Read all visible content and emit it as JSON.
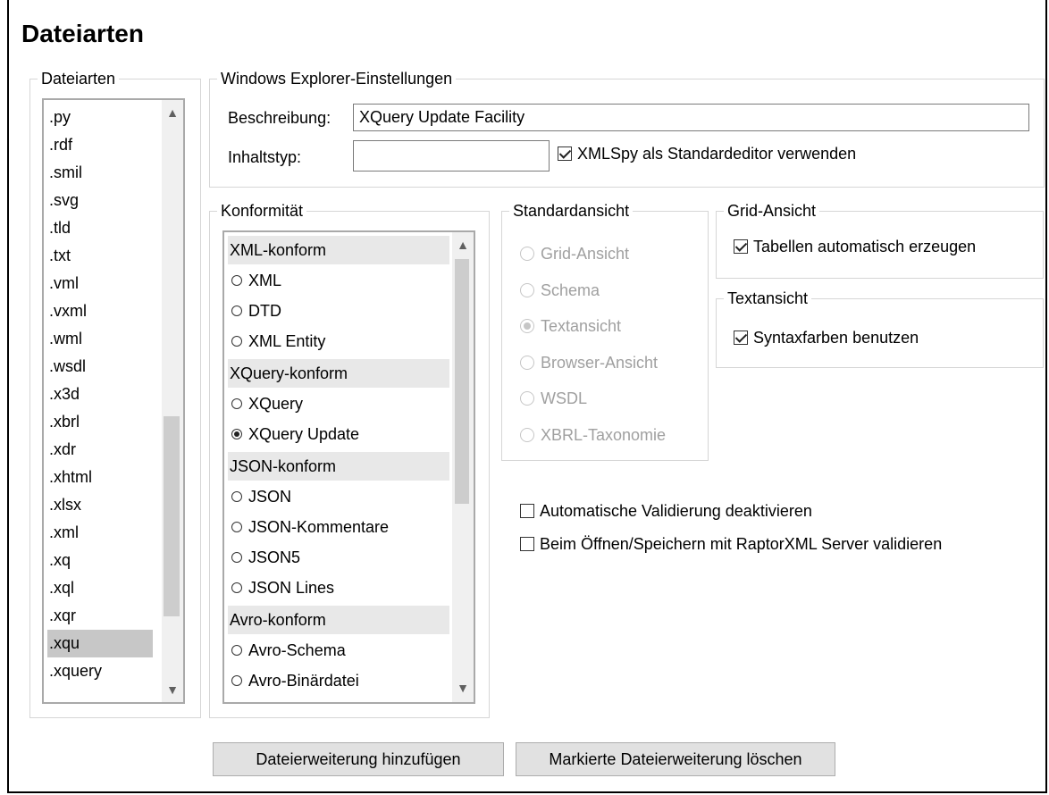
{
  "title": "Dateiarten",
  "filetypes": {
    "legend": "Dateiarten",
    "items": [
      ".py",
      ".rdf",
      ".smil",
      ".svg",
      ".tld",
      ".txt",
      ".vml",
      ".vxml",
      ".wml",
      ".wsdl",
      ".x3d",
      ".xbrl",
      ".xdr",
      ".xhtml",
      ".xlsx",
      ".xml",
      ".xq",
      ".xql",
      ".xqr",
      ".xqu",
      ".xquery"
    ],
    "selected": ".xqu"
  },
  "explorer": {
    "legend": "Windows Explorer-Einstellungen",
    "description_label": "Beschreibung:",
    "description_value": "XQuery Update Facility",
    "content_type_label": "Inhaltstyp:",
    "content_type_value": "",
    "default_editor_label": "XMLSpy als Standardeditor verwenden",
    "default_editor_checked": true
  },
  "conformance": {
    "legend": "Konformität",
    "groups": [
      {
        "header": "XML-konform",
        "items": [
          {
            "label": "XML",
            "checked": false
          },
          {
            "label": "DTD",
            "checked": false
          },
          {
            "label": "XML Entity",
            "checked": false
          }
        ]
      },
      {
        "header": "XQuery-konform",
        "items": [
          {
            "label": "XQuery",
            "checked": false
          },
          {
            "label": "XQuery Update",
            "checked": true
          }
        ]
      },
      {
        "header": "JSON-konform",
        "items": [
          {
            "label": "JSON",
            "checked": false
          },
          {
            "label": "JSON-Kommentare",
            "checked": false
          },
          {
            "label": "JSON5",
            "checked": false
          },
          {
            "label": "JSON Lines",
            "checked": false
          }
        ]
      },
      {
        "header": "Avro-konform",
        "items": [
          {
            "label": "Avro-Schema",
            "checked": false
          },
          {
            "label": "Avro-Binärdatei",
            "checked": false
          }
        ]
      }
    ]
  },
  "default_view": {
    "legend": "Standardansicht",
    "options": [
      {
        "label": "Grid-Ansicht",
        "checked": false
      },
      {
        "label": "Schema",
        "checked": false
      },
      {
        "label": "Textansicht",
        "checked": true
      },
      {
        "label": "Browser-Ansicht",
        "checked": false
      },
      {
        "label": "WSDL",
        "checked": false
      },
      {
        "label": "XBRL-Taxonomie",
        "checked": false
      }
    ]
  },
  "grid_view": {
    "legend": "Grid-Ansicht",
    "option_label": "Tabellen automatisch erzeugen",
    "checked": true
  },
  "text_view": {
    "legend": "Textansicht",
    "option_label": "Syntaxfarben benutzen",
    "checked": true
  },
  "validation": {
    "disable_auto_label": "Automatische Validierung deaktivieren",
    "disable_auto_checked": false,
    "raptor_label": "Beim Öffnen/Speichern mit RaptorXML Server validieren",
    "raptor_checked": false
  },
  "buttons": {
    "add_label": "Dateierweiterung hinzufügen",
    "delete_label": "Markierte Dateierweiterung löschen"
  }
}
